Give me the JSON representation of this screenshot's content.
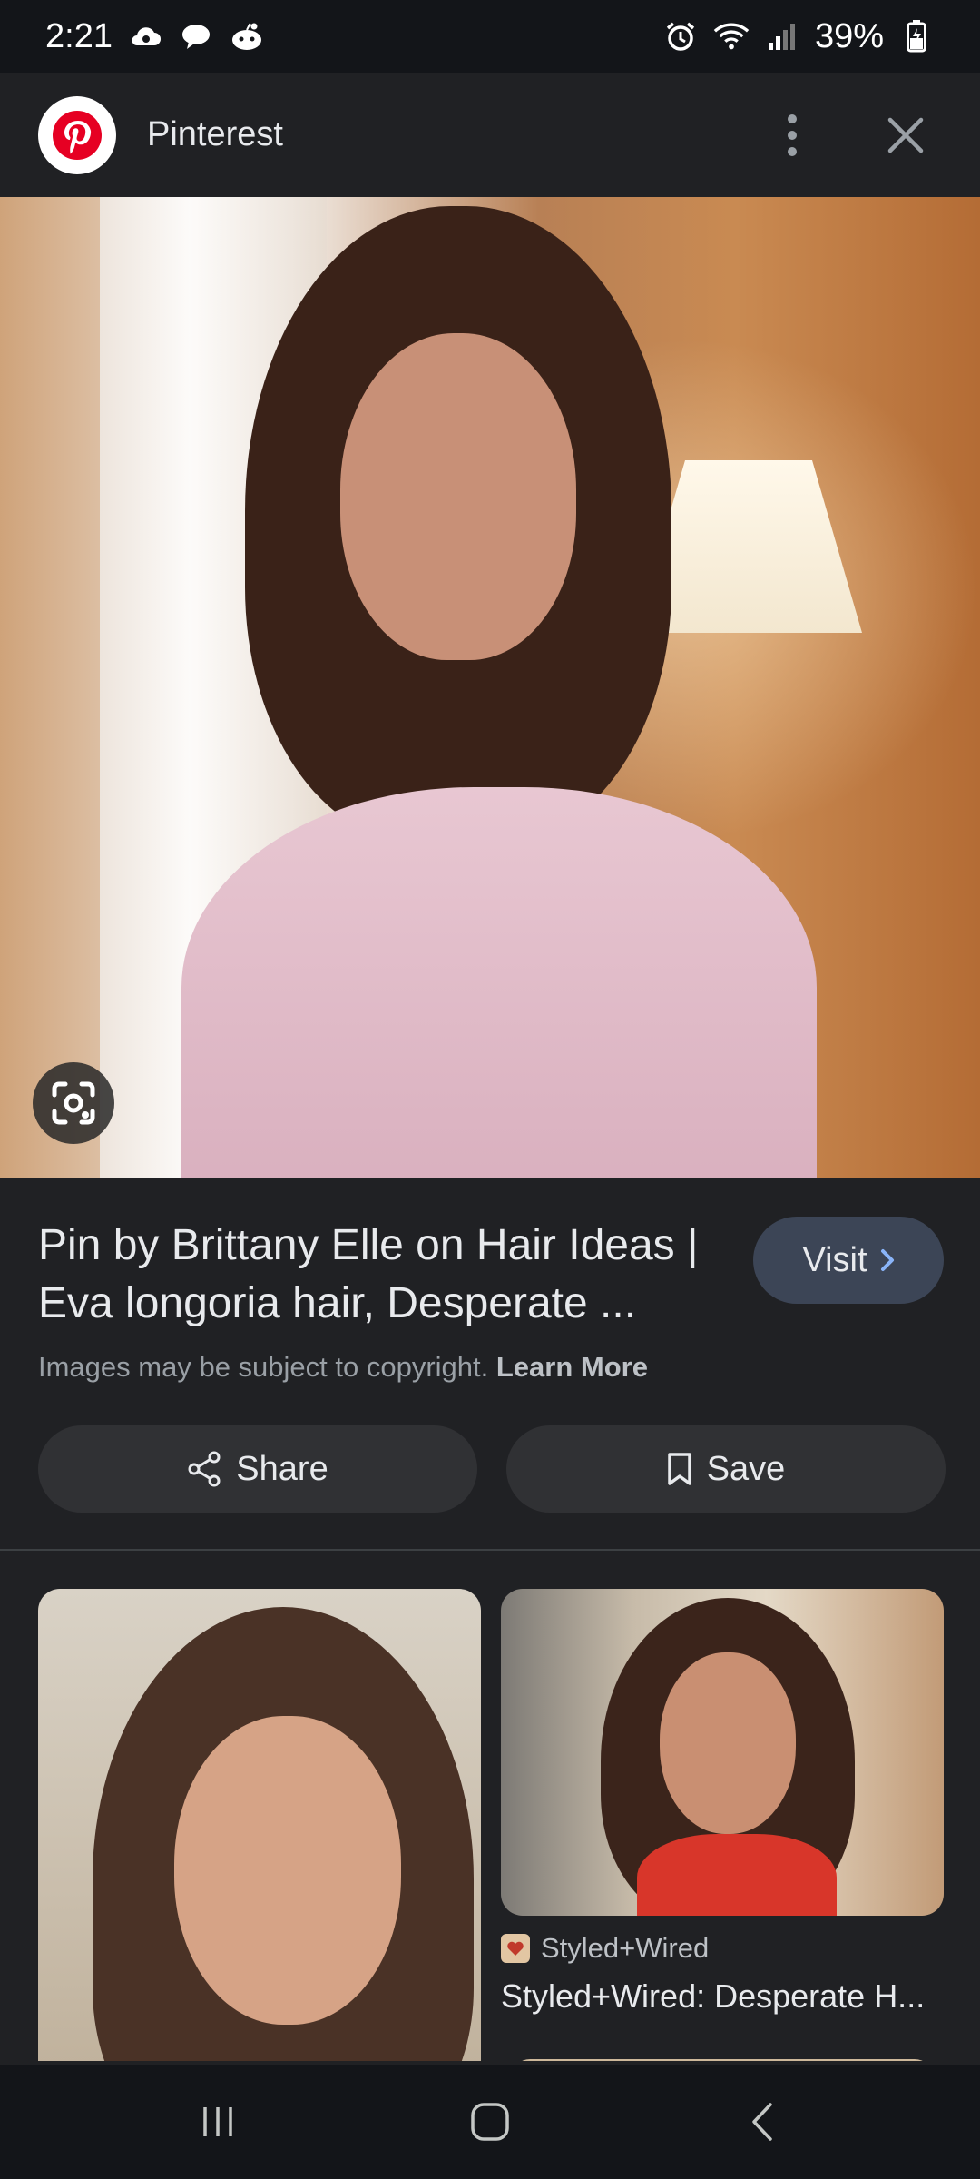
{
  "status_bar": {
    "time": "2:21",
    "battery": "39%",
    "icons_left": [
      "cloud-sync-icon",
      "chat-bubble-icon",
      "reddit-icon"
    ],
    "icons_right": [
      "alarm-icon",
      "wifi-icon",
      "signal-icon",
      "battery-charging-icon"
    ]
  },
  "header": {
    "site_name": "Pinterest",
    "logo_icon": "pinterest-logo-icon",
    "more_icon": "more-vert-icon",
    "close_icon": "close-icon"
  },
  "result": {
    "title": "Pin by Brittany Elle on Hair Ideas | Eva longoria hair, Desperate ...",
    "visit_label": "Visit",
    "copyright_text": "Images may be subject to copyright.",
    "learn_more": "Learn More",
    "share_label": "Share",
    "save_label": "Save"
  },
  "related": {
    "items": [
      {
        "source": "",
        "caption": ""
      },
      {
        "source": "Styled+Wired",
        "caption": "Styled+Wired: Desperate H..."
      }
    ]
  },
  "colors": {
    "background": "#202124",
    "status_bar": "#131519",
    "visit_button": "#3c4556",
    "pill_button": "#303134",
    "pinterest_red": "#e60023"
  }
}
